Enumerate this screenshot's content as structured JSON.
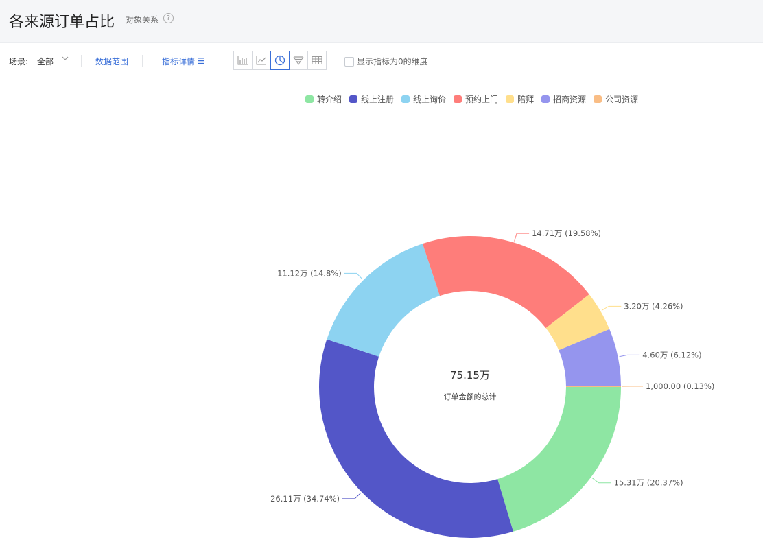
{
  "header": {
    "title": "各来源订单占比",
    "link": "对象关系",
    "help_icon": "help-circle-icon"
  },
  "toolbar": {
    "scene_label": "场景:",
    "scene_value": "全部",
    "data_range": "数据范围",
    "metric_detail": "指标详情",
    "metric_detail_icon": "list-icon",
    "chart_types": [
      {
        "name": "bar-chart-icon",
        "active": false
      },
      {
        "name": "line-chart-icon",
        "active": false
      },
      {
        "name": "pie-chart-icon",
        "active": true
      },
      {
        "name": "funnel-chart-icon",
        "active": false
      },
      {
        "name": "table-icon",
        "active": false
      }
    ],
    "show_zero_label": "显示指标为0的维度"
  },
  "chart_data": {
    "type": "pie",
    "donut": true,
    "legend_position": "top",
    "center_value": "75.15万",
    "center_label": "订单金额的总计",
    "slices": [
      {
        "name": "转介绍",
        "value": 153100,
        "label": "15.31万 (20.37%)",
        "color": "#8ee6a3"
      },
      {
        "name": "线上注册",
        "value": 261100,
        "label": "26.11万 (34.74%)",
        "color": "#5356c8"
      },
      {
        "name": "线上询价",
        "value": 111200,
        "label": "11.12万 (14.8%)",
        "color": "#8dd3f1"
      },
      {
        "name": "预约上门",
        "value": 147100,
        "label": "14.71万 (19.58%)",
        "color": "#fe7d7a"
      },
      {
        "name": "陪拜",
        "value": 32000,
        "label": "3.20万 (4.26%)",
        "color": "#ffdf8c"
      },
      {
        "name": "招商资源",
        "value": 46000,
        "label": "4.60万 (6.12%)",
        "color": "#9595ee"
      },
      {
        "name": "公司资源",
        "value": 1000,
        "label": "1,000.00 (0.13%)",
        "color": "#f9bd85"
      }
    ]
  }
}
